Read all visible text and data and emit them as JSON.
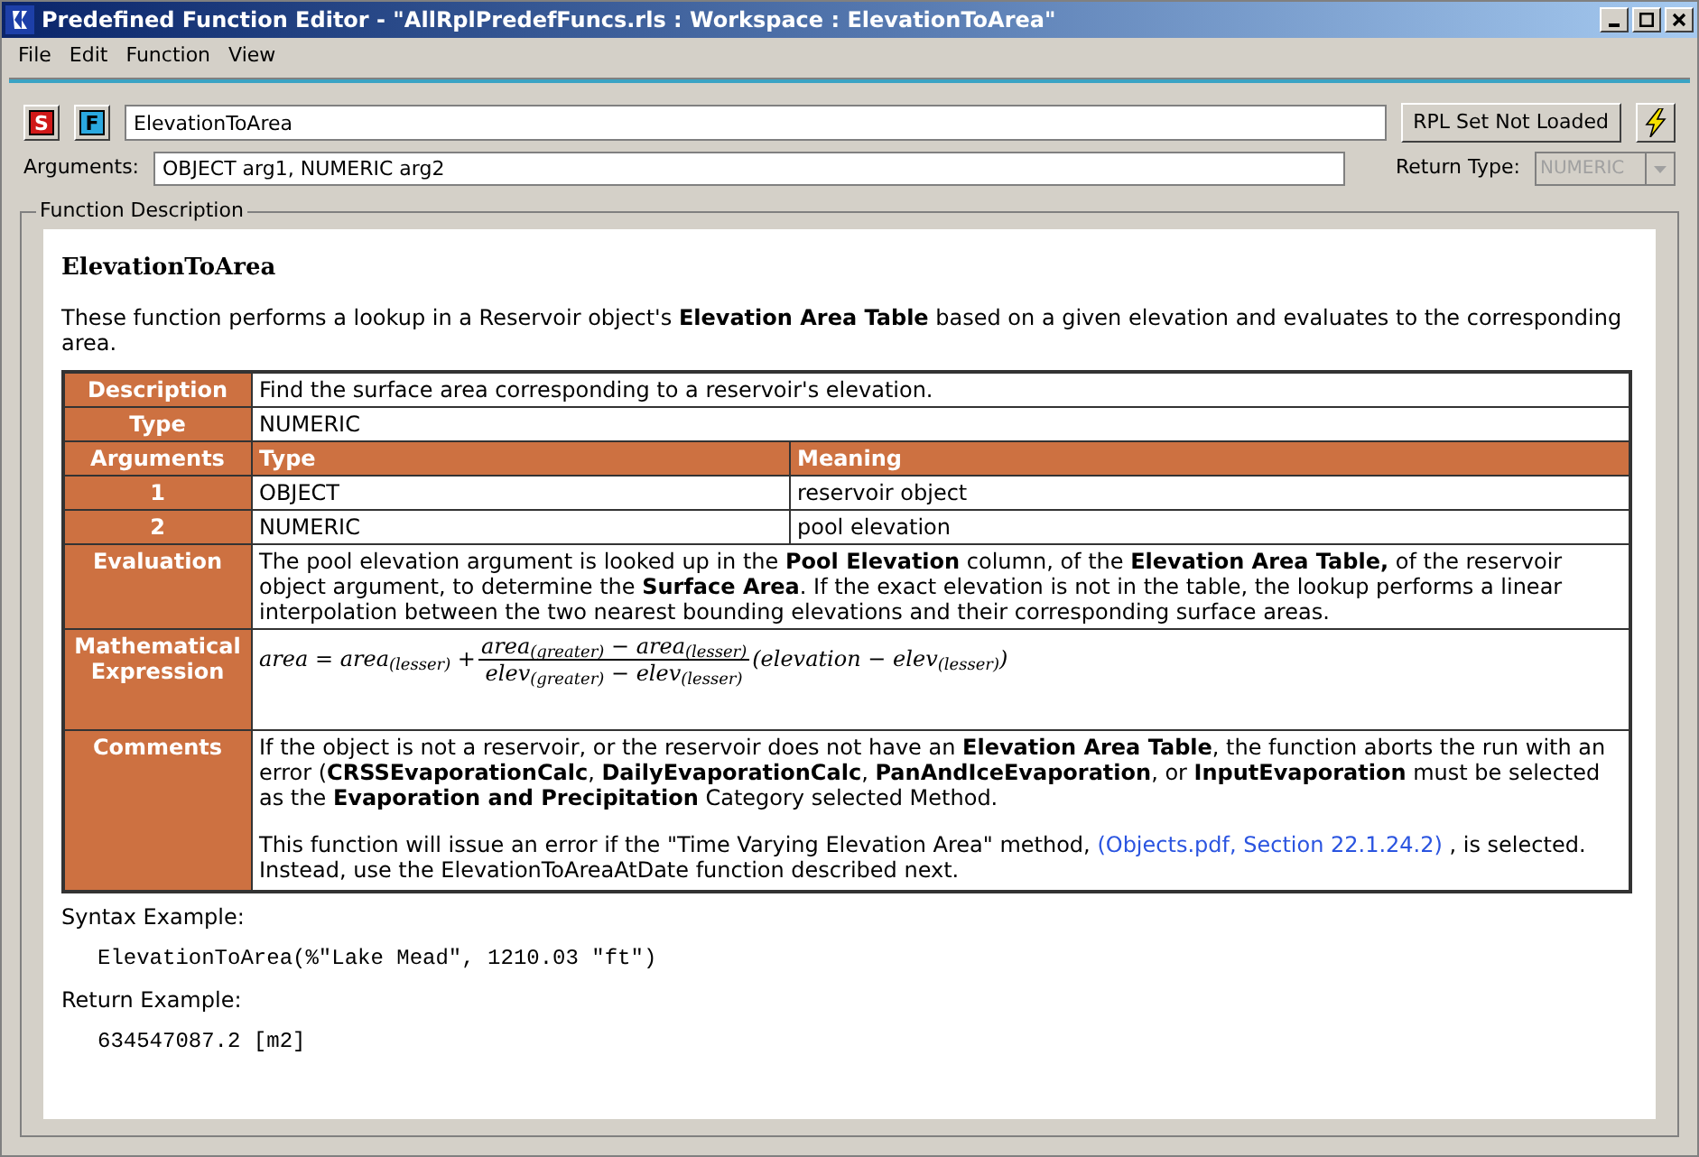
{
  "window": {
    "title": "Predefined Function Editor - \"AllRplPredefFuncs.rls : Workspace : ElevationToArea\""
  },
  "menu": [
    "File",
    "Edit",
    "Function",
    "View"
  ],
  "toolbar": {
    "s_button": "S",
    "f_button": "F",
    "name": "ElevationToArea",
    "rpl_button": "RPL Set Not Loaded"
  },
  "arguments": {
    "label": "Arguments:",
    "value": "OBJECT arg1, NUMERIC arg2",
    "return_label": "Return Type:",
    "return_value": "NUMERIC",
    "return_disabled": true
  },
  "group": {
    "title": "Function Description"
  },
  "doc": {
    "heading": "ElevationToArea",
    "intro": "These function performs a lookup in a Reservoir object's **Elevation Area Table** based on a given elevation and evaluates to the corresponding area.",
    "rows": [
      {
        "kind": "text",
        "header": "Description",
        "text": "Find the surface area corresponding to a reservoir's elevation."
      },
      {
        "kind": "text",
        "header": "Type",
        "text": "NUMERIC"
      },
      {
        "kind": "columns",
        "header": "Arguments",
        "columns": [
          "Type",
          "Meaning"
        ]
      },
      {
        "kind": "arg",
        "header": "1",
        "type": "OBJECT",
        "meaning": "reservoir object"
      },
      {
        "kind": "arg",
        "header": "2",
        "type": "NUMERIC",
        "meaning": "pool elevation"
      },
      {
        "kind": "text",
        "header": "Evaluation",
        "text": "The pool elevation argument is looked up in the **Pool Elevation** column, of the **Elevation Area Table,** of the reservoir object argument, to determine the **Surface Area**. If the exact elevation is not in the table, the lookup performs a linear interpolation between the two nearest bounding elevations and their corresponding surface areas."
      },
      {
        "kind": "formula",
        "header": "Mathematical Expression",
        "formula": {
          "left": "area = area$_{(lesser)}$ +",
          "numerator": "area$_{(greater)}$ − area$_{(lesser)}$",
          "denominator": "elev$_{(greater)}$ − elev$_{(lesser)}$",
          "right": "(elevation − elev$_{(lesser)}$)"
        }
      },
      {
        "kind": "paragraphs",
        "header": "Comments",
        "paragraphs": [
          {
            "text": "If the object is not a reservoir, or the reservoir does not have an **Elevation Area Table**, the function aborts the run with an error (**CRSSEvaporationCalc**, **DailyEvaporationCalc**, **PanAndIceEvaporation**, or **InputEvaporation** must be selected as the **Evaporation and Precipitation** Category selected Method."
          },
          {
            "text": "This function will issue an error if the \"Time Varying Elevation Area\" method,",
            "link": "(Objects.pdf, Section 22.1.24.2)",
            "after": ", is selected. Instead, use the ElevationToAreaAtDate function described next."
          }
        ]
      }
    ]
  },
  "syntax": {
    "label": "Syntax Example:",
    "code": "ElevationToArea(%\"Lake Mead\", 1210.03 \"ft\")"
  },
  "return_example": {
    "label": "Return Example:",
    "code": "634547087.2 [m2]"
  }
}
